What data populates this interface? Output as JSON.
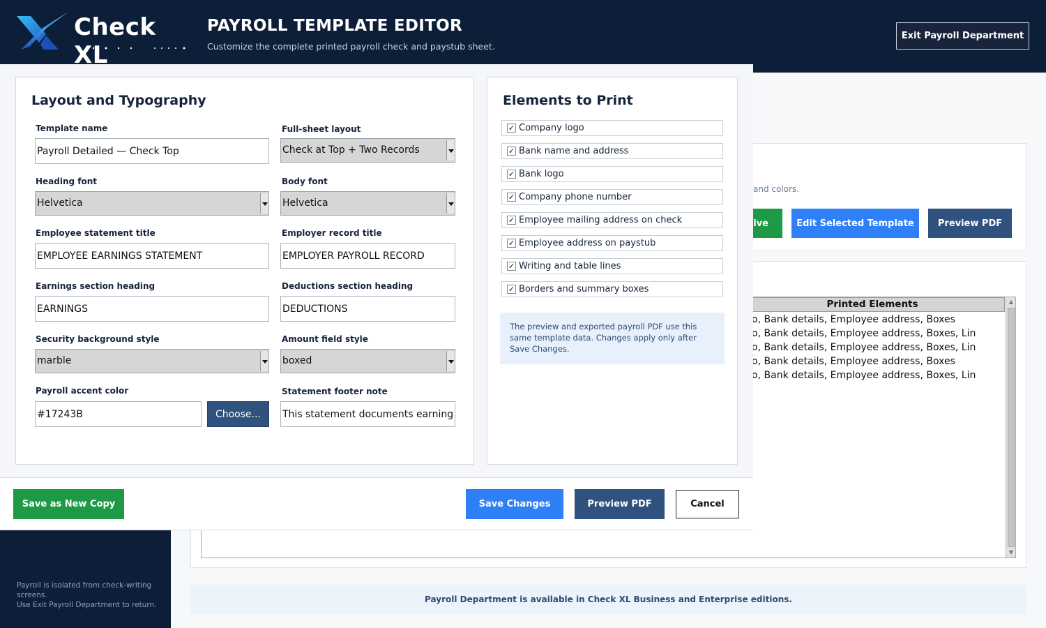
{
  "app": {
    "exit_button": "Exit Payroll Department",
    "sidebar_note_lines": [
      "Payroll is isolated from check-writing screens.",
      "Use Exit Payroll Department to return."
    ],
    "card_subtitle_fragment": ", and colors.",
    "card_buttons": {
      "active_fragment": "tive",
      "edit": "Edit Selected Template",
      "preview": "Preview PDF"
    },
    "table": {
      "column_header": "Printed Elements",
      "rows": [
        "mpany logo, Bank details, Employee address, Boxes",
        "mpany logo, Bank details, Employee address, Boxes, Lin",
        "mpany logo, Bank details, Employee address, Boxes, Lin",
        "mpany logo, Bank details, Employee address, Boxes",
        "mpany logo, Bank details, Employee address, Boxes, Lin"
      ]
    },
    "banner": "Payroll Department is available in Check XL Business and Enterprise editions."
  },
  "dialog": {
    "logo_text": "Check XL",
    "title": "PAYROLL TEMPLATE EDITOR",
    "subtitle": "Customize the complete printed payroll check and paystub sheet.",
    "layout_panel": {
      "title": "Layout and Typography",
      "template_name": {
        "label": "Template name",
        "value": "Payroll Detailed — Check Top"
      },
      "full_sheet_layout": {
        "label": "Full-sheet layout",
        "value": "Check at Top + Two Records"
      },
      "heading_font": {
        "label": "Heading font",
        "value": "Helvetica"
      },
      "body_font": {
        "label": "Body font",
        "value": "Helvetica"
      },
      "employee_statement_title": {
        "label": "Employee statement title",
        "value": "EMPLOYEE EARNINGS STATEMENT"
      },
      "employer_record_title": {
        "label": "Employer record title",
        "value": "EMPLOYER PAYROLL RECORD"
      },
      "earnings_heading": {
        "label": "Earnings section heading",
        "value": "EARNINGS"
      },
      "deductions_heading": {
        "label": "Deductions section heading",
        "value": "DEDUCTIONS"
      },
      "security_background": {
        "label": "Security background style",
        "value": "marble"
      },
      "amount_field_style": {
        "label": "Amount field style",
        "value": "boxed"
      },
      "accent_color": {
        "label": "Payroll accent color",
        "value": "#17243B",
        "button": "Choose..."
      },
      "footer_note": {
        "label": "Statement footer note",
        "value": "This statement documents earnings"
      }
    },
    "elements_panel": {
      "title": "Elements to Print",
      "items": [
        {
          "label": "Company logo",
          "checked": true
        },
        {
          "label": "Bank name and address",
          "checked": true
        },
        {
          "label": "Bank logo",
          "checked": true
        },
        {
          "label": "Company phone number",
          "checked": true
        },
        {
          "label": "Employee mailing address on check",
          "checked": true
        },
        {
          "label": "Employee address on paystub",
          "checked": true
        },
        {
          "label": "Writing and table lines",
          "checked": true
        },
        {
          "label": "Borders and summary boxes",
          "checked": true
        }
      ],
      "info": "The preview and exported payroll PDF use this same template data. Changes apply only after Save Changes."
    },
    "footer": {
      "save_copy": "Save as New Copy",
      "save": "Save Changes",
      "preview": "Preview PDF",
      "cancel": "Cancel"
    }
  },
  "colors": {
    "navy": "#0d1f38",
    "accent": "#17243B",
    "green": "#1e9a46",
    "blue": "#2f7ff6",
    "slate": "#2f527f"
  }
}
